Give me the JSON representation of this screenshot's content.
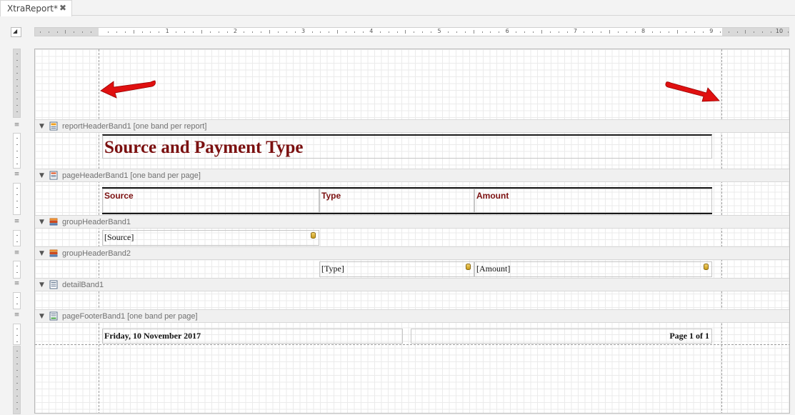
{
  "tab": {
    "title": "XtraReport*",
    "close_glyph": "✖"
  },
  "ruler": {
    "corner_glyph": "◢",
    "numbers": [
      "1",
      "2",
      "3",
      "4",
      "5",
      "6",
      "7",
      "8",
      "9",
      "10"
    ]
  },
  "bands": {
    "report_header": {
      "label": "reportHeaderBand1 [one band per report]",
      "icon": "report-header-band-icon"
    },
    "page_header": {
      "label": "pageHeaderBand1 [one band per page]",
      "icon": "page-header-band-icon"
    },
    "group_header_1": {
      "label": "groupHeaderBand1",
      "icon": "group-header-band-icon"
    },
    "group_header_2": {
      "label": "groupHeaderBand2",
      "icon": "group-header-band-icon"
    },
    "detail": {
      "label": "detailBand1",
      "icon": "detail-band-icon"
    },
    "page_footer": {
      "label": "pageFooterBand1 [one band per page]",
      "icon": "page-footer-band-icon"
    }
  },
  "report": {
    "title": "Source and Payment Type",
    "title_color": "#7b1010",
    "columns": {
      "source": "Source",
      "type": "Type",
      "amount": "Amount"
    },
    "fields": {
      "source": "[Source]",
      "type": "[Type]",
      "amount": "[Amount]"
    },
    "footer_date": "Friday, 10 November 2017",
    "footer_page": "Page 1 of 1"
  },
  "annotation_color": "#e01010"
}
